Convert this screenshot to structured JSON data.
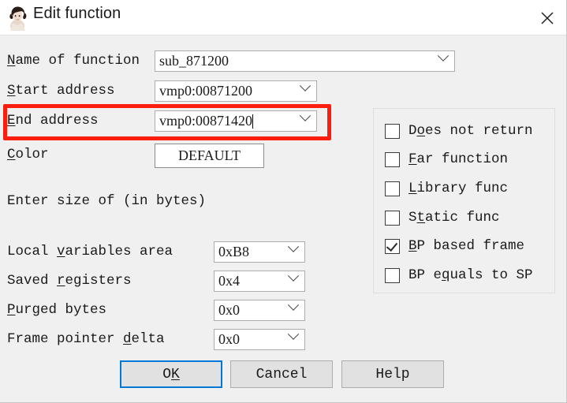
{
  "window": {
    "title": "Edit function",
    "icon": "ida-lovelace-icon",
    "close_label": "✕"
  },
  "form": {
    "rows": [
      {
        "label_pre": "",
        "label_mnemonic": "N",
        "label_post": "ame of function",
        "value": "sub_871200",
        "kind": "combo"
      },
      {
        "label_pre": "",
        "label_mnemonic": "S",
        "label_post": "tart address",
        "value": "vmp0:00871200",
        "kind": "combo"
      },
      {
        "label_pre": "",
        "label_mnemonic": "E",
        "label_post": "nd address",
        "value": "vmp0:00871420",
        "kind": "combo"
      },
      {
        "label_pre": "",
        "label_mnemonic": "C",
        "label_post": "olor",
        "value": "DEFAULT",
        "kind": "button"
      }
    ]
  },
  "size_section": {
    "heading": "Enter size of (in bytes)",
    "rows": [
      {
        "label_pre": "Local ",
        "label_mnemonic": "v",
        "label_post": "ariables area",
        "value": "0xB8"
      },
      {
        "label_pre": "Saved ",
        "label_mnemonic": "r",
        "label_post": "egisters",
        "value": "0x4"
      },
      {
        "label_pre": "",
        "label_mnemonic": "P",
        "label_post": "urged bytes",
        "value": "0x0"
      },
      {
        "label_pre": "Frame pointer ",
        "label_mnemonic": "d",
        "label_post": "elta",
        "value": "0x0"
      }
    ]
  },
  "attributes": {
    "items": [
      {
        "pre": "D",
        "mnemonic": "o",
        "post": "es not return",
        "checked": false
      },
      {
        "pre": "",
        "mnemonic": "F",
        "post": "ar function",
        "checked": false
      },
      {
        "pre": "",
        "mnemonic": "L",
        "post": "ibrary func",
        "checked": false
      },
      {
        "pre": "S",
        "mnemonic": "t",
        "post": "atic func",
        "checked": false
      },
      {
        "pre": "",
        "mnemonic": "B",
        "post": "P based frame",
        "checked": true
      },
      {
        "pre": "BP e",
        "mnemonic": "q",
        "post": "uals to SP",
        "checked": false
      }
    ]
  },
  "buttons": {
    "ok_pre": "O",
    "ok_mnemonic": "K",
    "ok_post": "",
    "cancel": "Cancel",
    "help": "Help"
  },
  "annotation": {
    "color": "#fa1e0e",
    "target": "End address"
  },
  "colors": {
    "dialog_bg": "#f0f0f0",
    "titlebar_bg": "#ffffff",
    "accent_focus": "#0078d7",
    "highlight": "#fa1e0e"
  }
}
